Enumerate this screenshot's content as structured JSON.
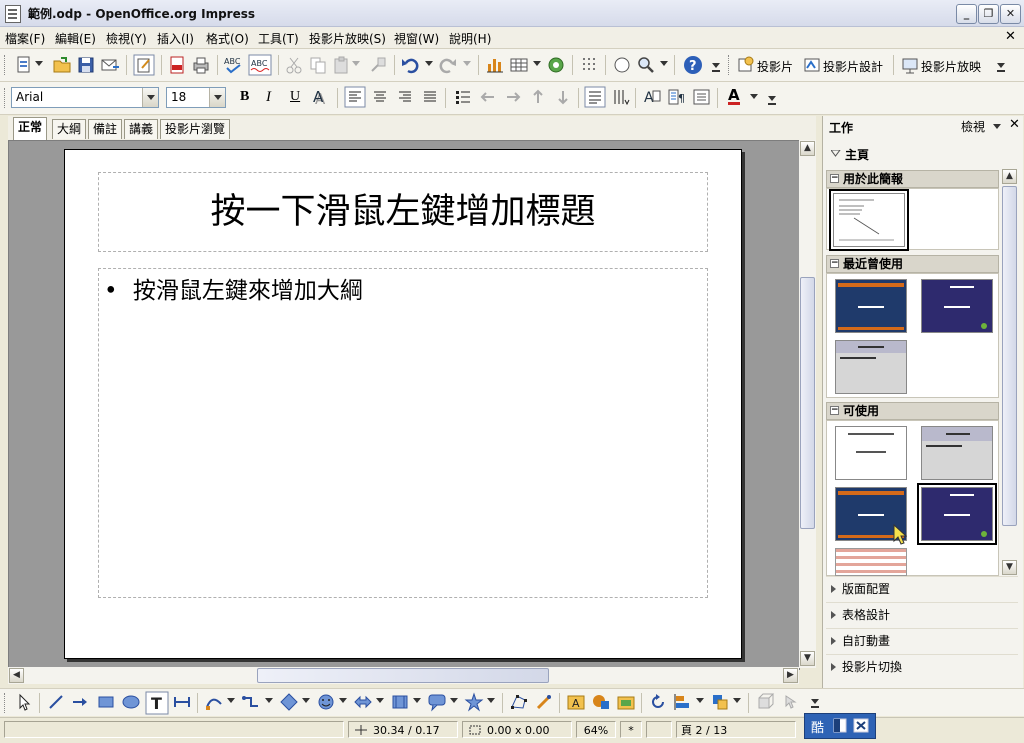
{
  "window": {
    "title": "範例.odp - OpenOffice.org Impress",
    "minimize": "_",
    "maximize": "❐",
    "close": "✕"
  },
  "menu": {
    "items": [
      "檔案(F)",
      "編輯(E)",
      "檢視(Y)",
      "插入(I)",
      "格式(O)",
      "工具(T)",
      "投影片放映(S)",
      "視窗(W)",
      "說明(H)"
    ],
    "close": "✕"
  },
  "standard_toolbar": {
    "slide_label": "投影片",
    "slide_design_label": "投影片設計",
    "slideshow_label": "投影片放映"
  },
  "format_toolbar": {
    "font_name": "Arial",
    "font_size": "18",
    "bold": "B",
    "italic": "I",
    "underline": "U",
    "font_color": "A"
  },
  "view_tabs": {
    "normal": "正常",
    "outline": "大綱",
    "notes": "備註",
    "handout": "講義",
    "slide_sorter": "投影片瀏覽"
  },
  "slide": {
    "title_placeholder": "按一下滑鼠左鍵增加標題",
    "bullet": "•",
    "body_placeholder": "按滑鼠左鍵來增加大綱"
  },
  "task_pane": {
    "title": "工作",
    "view_label": "檢視",
    "close": "✕",
    "group": "主頁",
    "sections": {
      "used": "用於此簡報",
      "recent": "最近曾使用",
      "available": "可使用"
    },
    "collapsed": [
      "版面配置",
      "表格設計",
      "自訂動畫",
      "投影片切換"
    ]
  },
  "status": {
    "position": "30.34 / 0.17",
    "size": "0.00 x 0.00",
    "zoom": "64%",
    "modified": "*",
    "page": "頁 2 / 13"
  },
  "ime": {
    "label": "酷"
  }
}
